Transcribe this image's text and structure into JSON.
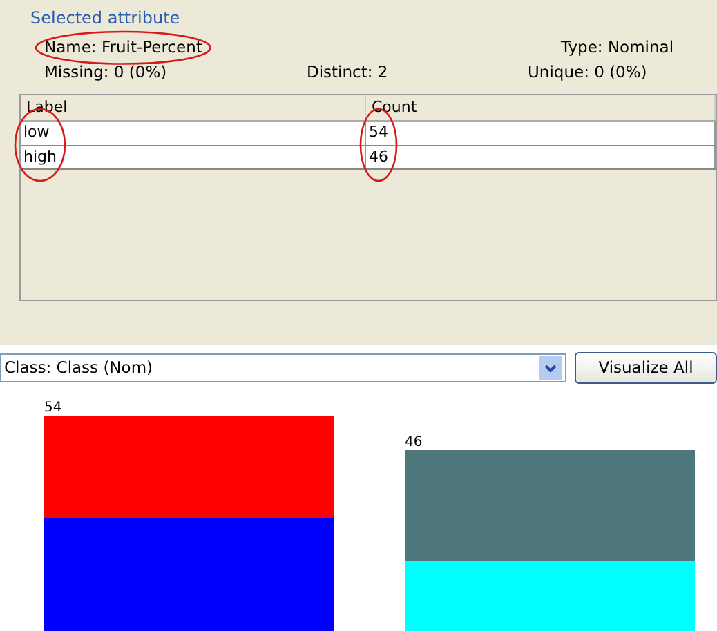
{
  "panel": {
    "title": "Selected attribute"
  },
  "attribute": {
    "name": {
      "text": "Name: Fruit-Percent",
      "circled": true
    },
    "type": "Type: Nominal",
    "missing": "Missing: 0 (0%)",
    "distinct": "Distinct: 2",
    "unique": "Unique: 0 (0%)"
  },
  "table": {
    "columns": [
      {
        "title": "Label",
        "circled": true
      },
      {
        "title": "Count",
        "circled": true
      }
    ],
    "rows": [
      [
        "low",
        "54"
      ],
      [
        "high",
        "46"
      ]
    ]
  },
  "class_selector": {
    "value": "Class: Class (Nom)"
  },
  "buttons": [
    "Visualize All"
  ],
  "histogram": {
    "bars": [
      {
        "label": "54",
        "segments": [
          {
            "color": "#ff0000"
          },
          {
            "color": "#0000ff"
          }
        ]
      },
      {
        "label": "46",
        "segments": [
          {
            "color": "#4d777b"
          },
          {
            "color": "#00ffff"
          }
        ]
      }
    ]
  }
}
